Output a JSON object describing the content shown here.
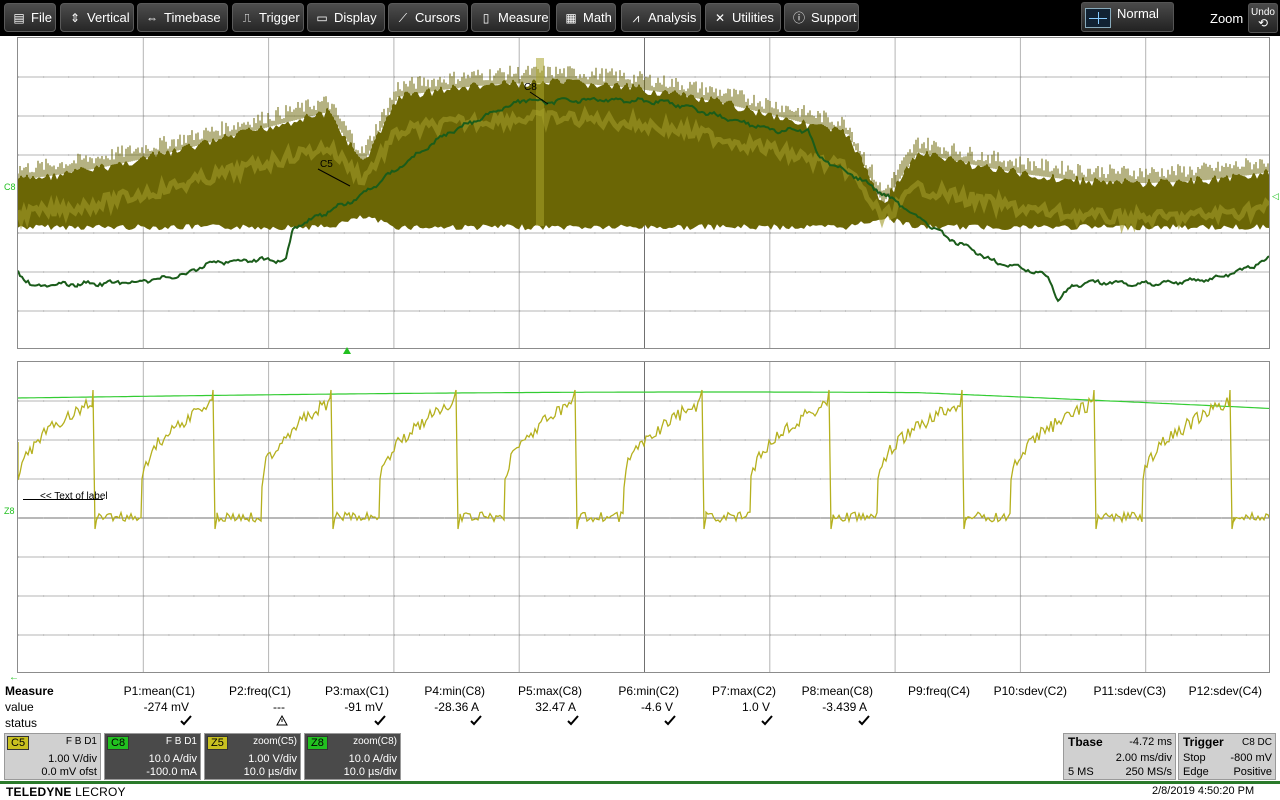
{
  "menu": {
    "items": [
      {
        "label": "File",
        "icon": "file-icon"
      },
      {
        "label": "Vertical",
        "icon": "vertical-arrows-icon"
      },
      {
        "label": "Timebase",
        "icon": "horizontal-arrows-icon"
      },
      {
        "label": "Trigger",
        "icon": "trigger-icon"
      },
      {
        "label": "Display",
        "icon": "display-icon"
      },
      {
        "label": "Cursors",
        "icon": "cursors-icon"
      },
      {
        "label": "Measure",
        "icon": "measure-icon"
      },
      {
        "label": "Math",
        "icon": "math-icon"
      },
      {
        "label": "Analysis",
        "icon": "analysis-icon"
      },
      {
        "label": "Utilities",
        "icon": "utilities-icon"
      },
      {
        "label": "Support",
        "icon": "info-icon"
      }
    ],
    "trigger_mode": "Normal",
    "zoom_label": "Zoom",
    "undo_label": "Undo"
  },
  "grid1": {
    "trace_labels": {
      "c5": "C5",
      "c8": "C8"
    },
    "left_marker": "C8"
  },
  "grid2": {
    "text_label": "<< Text of label",
    "left_marker": "Z8"
  },
  "colors": {
    "c5_trace": "#b5b01e",
    "c5_envelope": "#6b6605",
    "c8_trace": "#1a5c1a",
    "z8_trace": "#33cc33",
    "grid_line": "#a0a0a0",
    "accent_green": "#22c020"
  },
  "measure": {
    "title": "Measure",
    "row_labels": {
      "value": "value",
      "status": "status"
    },
    "columns": [
      {
        "param": "P1:mean(C1)",
        "value": "-274 mV",
        "status": "ok"
      },
      {
        "param": "P2:freq(C1)",
        "value": "---",
        "status": "warning"
      },
      {
        "param": "P3:max(C1)",
        "value": "-91 mV",
        "status": "ok"
      },
      {
        "param": "P4:min(C8)",
        "value": "-28.36 A",
        "status": "ok"
      },
      {
        "param": "P5:max(C8)",
        "value": "32.47 A",
        "status": "ok"
      },
      {
        "param": "P6:min(C2)",
        "value": "-4.6 V",
        "status": "ok"
      },
      {
        "param": "P7:max(C2)",
        "value": "1.0 V",
        "status": "ok"
      },
      {
        "param": "P8:mean(C8)",
        "value": "-3.439 A",
        "status": "ok"
      },
      {
        "param": "P9:freq(C4)",
        "value": "",
        "status": ""
      },
      {
        "param": "P10:sdev(C2)",
        "value": "",
        "status": ""
      },
      {
        "param": "P11:sdev(C3)",
        "value": "",
        "status": ""
      },
      {
        "param": "P12:sdev(C4)",
        "value": "",
        "status": ""
      }
    ]
  },
  "channels": [
    {
      "tag": "C5",
      "flags": "F B D1",
      "line1": "1.00 V/div",
      "line2": "0.0 mV ofst",
      "tag_color": "#c8c020",
      "dark": false
    },
    {
      "tag": "C8",
      "flags": "F B D1",
      "line1": "10.0 A/div",
      "line2": "-100.0 mA",
      "tag_color": "#22c020",
      "dark": true
    },
    {
      "tag": "Z5",
      "flags": "zoom(C5)",
      "line1": "1.00 V/div",
      "line2": "10.0 µs/div",
      "tag_color": "#c8c020",
      "dark": true
    },
    {
      "tag": "Z8",
      "flags": "zoom(C8)",
      "line1": "10.0 A/div",
      "line2": "10.0 µs/div",
      "tag_color": "#22c020",
      "dark": true
    }
  ],
  "timebase": {
    "title": "Tbase",
    "delay": "-4.72 ms",
    "per_div": "2.00 ms/div",
    "samples": "5 MS",
    "rate": "250 MS/s"
  },
  "trigger": {
    "title": "Trigger",
    "source": "C8 DC",
    "mode": "Stop",
    "level": "-800 mV",
    "type": "Edge",
    "slope": "Positive"
  },
  "footer": {
    "brand_bold": "TELEDYNE",
    "brand_light": "LECROY",
    "datetime": "2/8/2019 4:50:20 PM"
  }
}
